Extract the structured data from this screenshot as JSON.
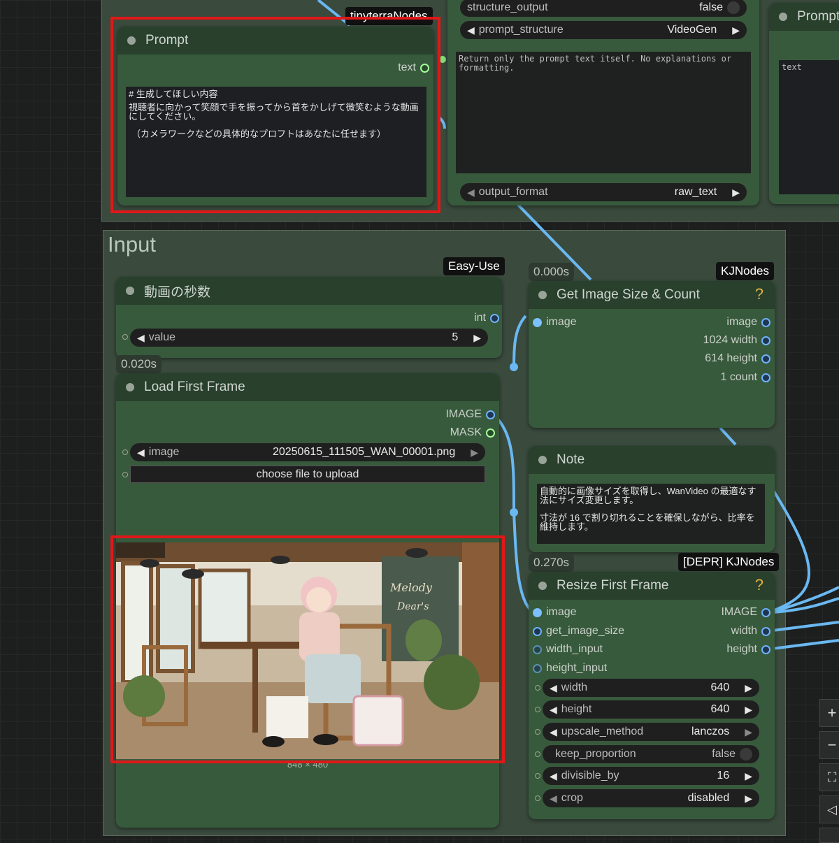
{
  "groups": {
    "input_title": "Input"
  },
  "prompt_node": {
    "title": "Prompt",
    "badge": "tinyterraNodes",
    "output_label": "text",
    "text_lines": [
      "# 生成してほしい内容",
      "視聴者に向かって笑顔で手を振ってから首をかしげて微笑むような動画",
      "にしてください。",
      "（カメラワークなどの具体的なプロフトはあなたに任せます）"
    ]
  },
  "llm_node": {
    "structure_output_label": "structure_output",
    "structure_output_value": "false",
    "prompt_structure_label": "prompt_structure",
    "prompt_structure_value": "VideoGen",
    "system_text_1": "Return only the prompt text itself. No explanations or",
    "system_text_2": "formatting.",
    "output_format_label": "output_format",
    "output_format_value": "raw_text"
  },
  "right_prompt_node": {
    "title": "Prompt",
    "text_placeholder": "text"
  },
  "duration_node": {
    "badge": "Easy-Use",
    "title": "動画の秒数",
    "output_label": "int",
    "widget_label": "value",
    "widget_value": "5"
  },
  "load_node": {
    "time": "0.020s",
    "title": "Load First Frame",
    "outputs": [
      "IMAGE",
      "MASK"
    ],
    "image_label": "image",
    "image_value": "20250615_111505_WAN_00001.png",
    "upload_label": "choose file to upload",
    "size_caption": "848 × 480"
  },
  "size_node": {
    "time": "0.000s",
    "badge": "KJNodes",
    "title": "Get Image Size & Count",
    "input_label": "image",
    "outputs": [
      "image",
      "1024 width",
      "614 height",
      "1 count"
    ]
  },
  "note_node": {
    "title": "Note",
    "lines": [
      "自動的に画像サイズを取得し、WanVideo の最適なす",
      "法にサイズ変更します。",
      "寸法が 16 で割り切れることを確保しながら、比率を",
      "維持します。"
    ]
  },
  "resize_node": {
    "time": "0.270s",
    "badge": "[DEPR] KJNodes",
    "title": "Resize First Frame",
    "inputs": [
      "image",
      "get_image_size",
      "width_input",
      "height_input"
    ],
    "outputs": [
      "IMAGE",
      "width",
      "height"
    ],
    "widgets": [
      {
        "label": "width",
        "value": "640"
      },
      {
        "label": "height",
        "value": "640"
      },
      {
        "label": "upscale_method",
        "value": "lanczos"
      },
      {
        "label": "keep_proportion",
        "value": "false"
      },
      {
        "label": "divisible_by",
        "value": "16"
      },
      {
        "label": "crop",
        "value": "disabled"
      }
    ]
  },
  "toolbar": {
    "zoom_in": "+",
    "zoom_out": "−",
    "fit": "⛶",
    "select": "◁"
  },
  "accent_colors": {
    "wire_blue": "#6ab8f2",
    "highlight_red": "#e01818",
    "help_yellow": "#e5b33c"
  }
}
